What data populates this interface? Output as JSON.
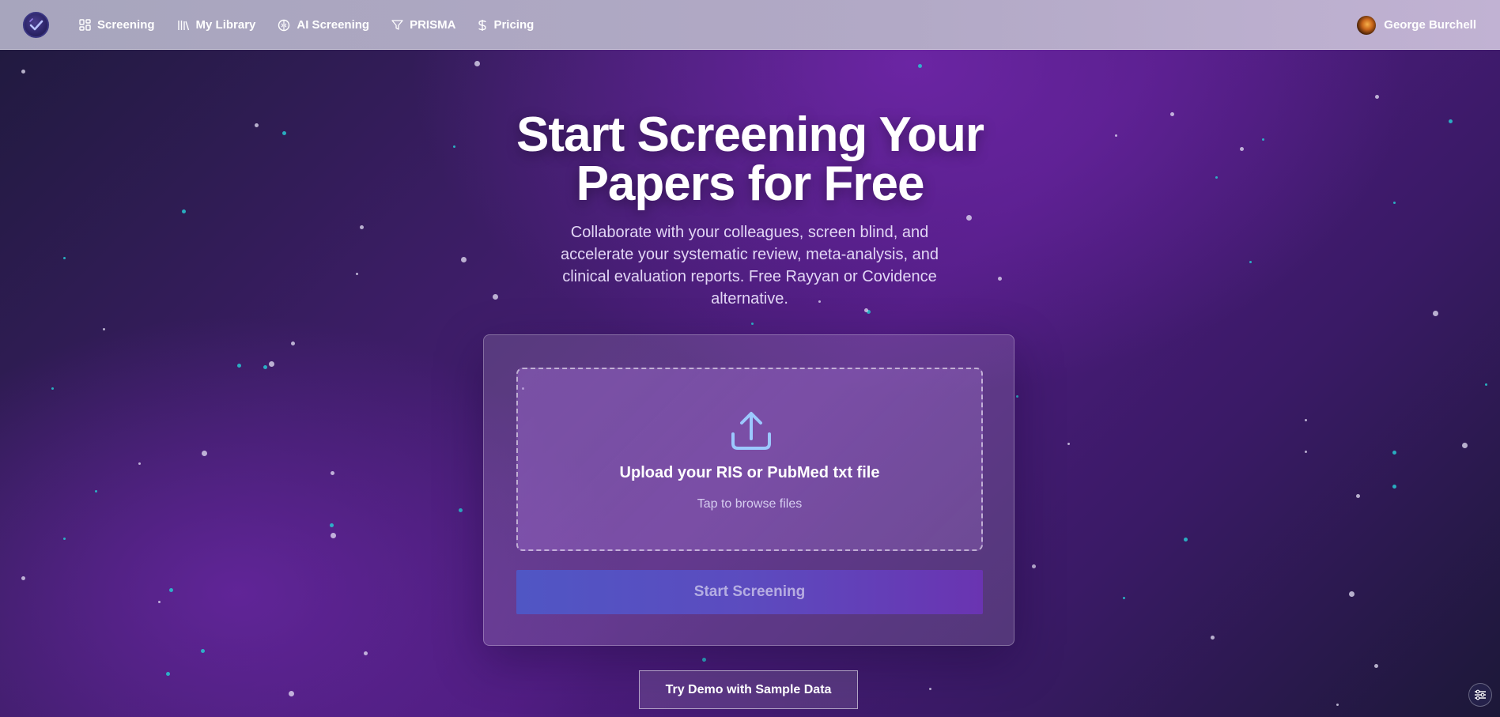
{
  "nav": {
    "items": [
      {
        "label": "Screening",
        "icon": "grid-icon"
      },
      {
        "label": "My Library",
        "icon": "library-icon"
      },
      {
        "label": "AI Screening",
        "icon": "brain-icon"
      },
      {
        "label": "PRISMA",
        "icon": "filter-icon"
      },
      {
        "label": "Pricing",
        "icon": "dollar-icon"
      }
    ],
    "user_name": "George Burchell"
  },
  "hero": {
    "title_line1": "Start Screening Your",
    "title_line2": "Papers for Free",
    "subtitle": "Collaborate with your colleagues, screen blind, and accelerate your systematic review, meta-analysis, and clinical evaluation reports. Free Rayyan or Covidence alternative."
  },
  "upload": {
    "title": "Upload your RIS or PubMed txt file",
    "hint": "Tap to browse files",
    "start_button": "Start Screening"
  },
  "demo_button": "Try Demo with Sample Data",
  "colors": {
    "accent_start": "#5056c4",
    "accent_end": "#6a34b1",
    "upload_icon": "#9cc8ff"
  }
}
